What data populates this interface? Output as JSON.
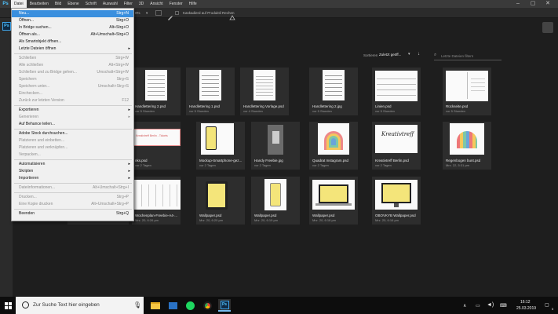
{
  "app": {
    "logo": "Ps",
    "window_controls": [
      "–",
      "▢",
      "✕"
    ]
  },
  "menubar": [
    "Datei",
    "Bearbeiten",
    "Bild",
    "Ebene",
    "Schrift",
    "Auswahl",
    "Filter",
    "3D",
    "Ansicht",
    "Fenster",
    "Hilfe"
  ],
  "options_bar": {
    "zoom": "0%",
    "checkbox_label": "Kaskadierd auf Produktil Rechen"
  },
  "sort": {
    "label": "Sortieren",
    "value": "Zuletzt geöff...",
    "filter_placeholder": "Letzte Dateien filtern"
  },
  "menu": [
    {
      "label": "Neu...",
      "shortcut": "Strg+N",
      "highlight": true
    },
    {
      "label": "Öffnen...",
      "shortcut": "Strg+O"
    },
    {
      "label": "In Bridge suchen...",
      "shortcut": "Alt+Strg+O"
    },
    {
      "label": "Öffnen als...",
      "shortcut": "Alt+Umschalt+Strg+O"
    },
    {
      "label": "Als Smartobjekt öffnen...",
      "shortcut": ""
    },
    {
      "label": "Letzte Dateien öffnen",
      "shortcut": "",
      "submenu": true
    },
    {
      "sep": true
    },
    {
      "label": "Schließen",
      "shortcut": "Strg+W",
      "disabled": true
    },
    {
      "label": "Alle schließen",
      "shortcut": "Alt+Strg+W",
      "disabled": true
    },
    {
      "label": "Schließen und zu Bridge gehen...",
      "shortcut": "Umschalt+Strg+W",
      "disabled": true
    },
    {
      "label": "Speichern",
      "shortcut": "Strg+S",
      "disabled": true
    },
    {
      "label": "Speichern unter...",
      "shortcut": "Umschalt+Strg+S",
      "disabled": true
    },
    {
      "label": "Einchecken...",
      "shortcut": "",
      "disabled": true
    },
    {
      "label": "Zurück zur letzten Version",
      "shortcut": "F12",
      "disabled": true
    },
    {
      "sep": true
    },
    {
      "label": "Exportieren",
      "shortcut": "",
      "submenu": true
    },
    {
      "label": "Generieren",
      "shortcut": "",
      "submenu": true,
      "disabled": true
    },
    {
      "label": "Auf Behance teilen...",
      "shortcut": ""
    },
    {
      "sep": true
    },
    {
      "label": "Adobe Stock durchsuchen...",
      "shortcut": ""
    },
    {
      "label": "Platzieren und einbetten...",
      "shortcut": "",
      "disabled": true
    },
    {
      "label": "Platzieren und verknüpfen...",
      "shortcut": "",
      "disabled": true
    },
    {
      "label": "Verpacken...",
      "shortcut": "",
      "disabled": true
    },
    {
      "sep": true
    },
    {
      "label": "Automatisieren",
      "shortcut": "",
      "submenu": true
    },
    {
      "label": "Skripten",
      "shortcut": "",
      "submenu": true
    },
    {
      "label": "Importieren",
      "shortcut": "",
      "submenu": true
    },
    {
      "sep": true
    },
    {
      "label": "Dateiinformationen...",
      "shortcut": "Alt+Umschalt+Strg+I",
      "disabled": true
    },
    {
      "sep": true
    },
    {
      "label": "Drucken...",
      "shortcut": "Strg+P",
      "disabled": true
    },
    {
      "label": "Eine Kopie drucken",
      "shortcut": "Alt+Umschalt+Strg+P",
      "disabled": true
    },
    {
      "sep": true
    },
    {
      "label": "Beenden",
      "shortcut": "Strg+Q"
    }
  ],
  "files": [
    {
      "name": "",
      "time": ""
    },
    {
      "name": "Handlettering 2.psd",
      "time": "vor 5 Stunden"
    },
    {
      "name": "Handlettering 1.psd",
      "time": "vor 5 Stunden"
    },
    {
      "name": "Handlettering Vorlage.psd",
      "time": "vor 4 Stunden"
    },
    {
      "name": "Handlettering 2.jpg",
      "time": "vor 5 Stunden"
    },
    {
      "name": "Linien.psd",
      "time": "vor 5 Stunden"
    },
    {
      "name": "Rückseite.psd",
      "time": "vor 5 Stunden"
    },
    {
      "name": "nks.psd",
      "time": "vor 2 Tagen"
    },
    {
      "name": "Mockup-Smartphone-gez...",
      "time": "vor 2 Tagen"
    },
    {
      "name": "Handy Freebie.jpg",
      "time": "vor 2 Tagen"
    },
    {
      "name": "Quadrat Instagram.psd",
      "time": "vor 2 Tagen"
    },
    {
      "name": "Kreativtreff Berlin.psd",
      "time": "vor 2 Tagen"
    },
    {
      "name": "Regenbogen bunt.psd",
      "time": "Mrz. 22, 5:31 pm"
    },
    {
      "name": "Wochenplan-Freebie-A4-...",
      "time": "Mrz. 20, 6:26 pm"
    },
    {
      "name": "Wallpaper.psd",
      "time": "Mrz. 20, 6:20 pm"
    },
    {
      "name": "Wallpaper.psd",
      "time": "Mrz. 20, 6:19 pm"
    },
    {
      "name": "Wallpaper.psd",
      "time": "Mrz. 20, 6:18 pm"
    },
    {
      "name": "OBOVKYB Wallpaper.psd",
      "time": "Mrz. 20, 6:16 pm"
    }
  ],
  "thumb_texts": {
    "kreativtreff": "Kreativtreff",
    "banner": "Kreativtreff Berlin - Tickets"
  },
  "taskbar": {
    "search_text": "Zur Suche Text hier eingeben",
    "time": "16:12",
    "date": "25.03.2019",
    "notif": "5"
  },
  "colors": {
    "accent": "#3a8fde",
    "ps_blue": "#4ec3ff"
  }
}
